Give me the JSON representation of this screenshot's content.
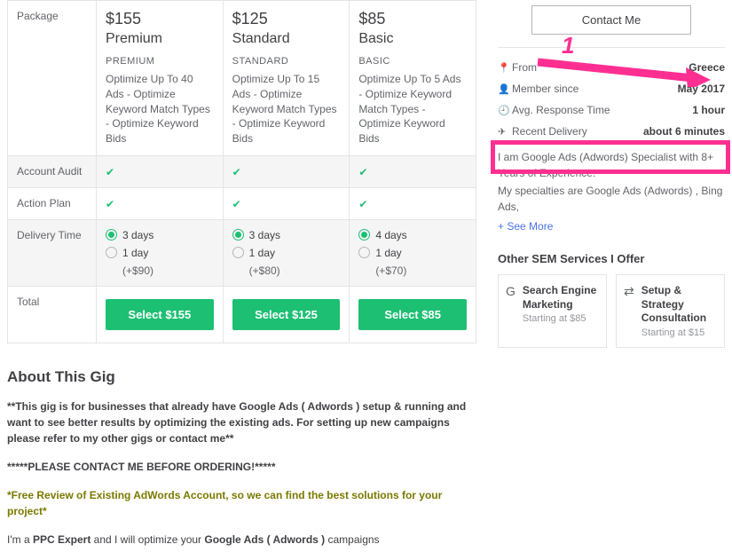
{
  "table": {
    "rowPackage": "Package",
    "rowAudit": "Account Audit",
    "rowPlan": "Action Plan",
    "rowDelivery": "Delivery Time",
    "rowTotal": "Total",
    "tiers": [
      {
        "price": "$155",
        "name": "Premium",
        "cap": "PREMIUM",
        "desc": "Optimize Up To 40 Ads - Optimize Keyword Match Types - Optimize Keyword Bids",
        "d1": "3 days",
        "d2": "1 day",
        "extra": "(+$90)",
        "btn": "Select $155"
      },
      {
        "price": "$125",
        "name": "Standard",
        "cap": "STANDARD",
        "desc": "Optimize Up To 15 Ads - Optimize Keyword Match Types - Optimize Keyword Bids",
        "d1": "3 days",
        "d2": "1 day",
        "extra": "(+$80)",
        "btn": "Select $125"
      },
      {
        "price": "$85",
        "name": "Basic",
        "cap": "BASIC",
        "desc": "Optimize Up To 5 Ads - Optimize Keyword Match Types - Optimize Keyword Bids",
        "d1": "4 days",
        "d2": "1 day",
        "extra": "(+$70)",
        "btn": "Select $85"
      }
    ]
  },
  "seller": {
    "contact": "Contact Me",
    "rows": [
      {
        "icon": "📍",
        "label": "From",
        "val": "Greece",
        "name": "from"
      },
      {
        "icon": "👤",
        "label": "Member since",
        "val": "May 2017",
        "name": "member-since"
      },
      {
        "icon": "🕘",
        "label": "Avg. Response Time",
        "val": "1 hour",
        "name": "response-time"
      },
      {
        "icon": "✈",
        "label": "Recent Delivery",
        "val": "about 6 minutes",
        "name": "recent-delivery"
      }
    ],
    "bio1": "I am Google Ads (Adwords) Specialist with 8+ Years of Experience.",
    "bio2": "My specialties are Google Ads (Adwords) , Bing Ads,",
    "seemore": "+ See More"
  },
  "services": {
    "heading": "Other SEM Services I Offer",
    "items": [
      {
        "icon": "G",
        "title": "Search Engine Marketing",
        "sub": "Starting at $85"
      },
      {
        "icon": "⇄",
        "title": "Setup & Strategy Consultation",
        "sub": "Starting at $15"
      }
    ]
  },
  "about": {
    "heading": "About This Gig",
    "p1": "**This gig is for businesses that already have Google Ads ( Adwords ) setup & running and want to see better results by optimizing the existing ads. For setting up new campaigns please refer to my other gigs or contact me**",
    "p2": "*****PLEASE CONTACT ME BEFORE ORDERING!*****",
    "p3": "*Free Review of Existing AdWords Account, so we can find the best solutions for your project*",
    "p4a": "I'm a ",
    "p4b": "PPC Expert",
    "p4c": " and I will optimize your ",
    "p4d": "Google Ads ( Adwords )",
    "p4e": " campaigns"
  },
  "annotation": {
    "num": "1"
  }
}
